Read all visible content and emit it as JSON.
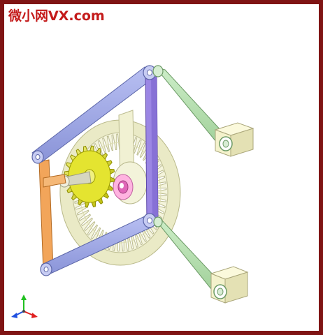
{
  "watermark": {
    "text": "微小网VX.com",
    "color": "#c41a1a"
  },
  "frame": {
    "border_color": "#7f1414",
    "background": "#ffffff"
  },
  "parts": {
    "ring_gear_color": "#ebebc8",
    "ring_gear_teeth": 60,
    "pinion_color": "#d8d80a",
    "pinion_teeth": 20,
    "hub_color": "#ff8cd2",
    "blue_link_color": "#9fa8e6",
    "purple_link_color": "#9b86e4",
    "green_link_color": "#b5dfb0",
    "orange_link_color": "#f2a55a",
    "slider_block_color": "#f2f0c8"
  },
  "axis_triad": {
    "x_color": "#e02020",
    "y_color": "#20c020",
    "z_color": "#2050e0"
  }
}
